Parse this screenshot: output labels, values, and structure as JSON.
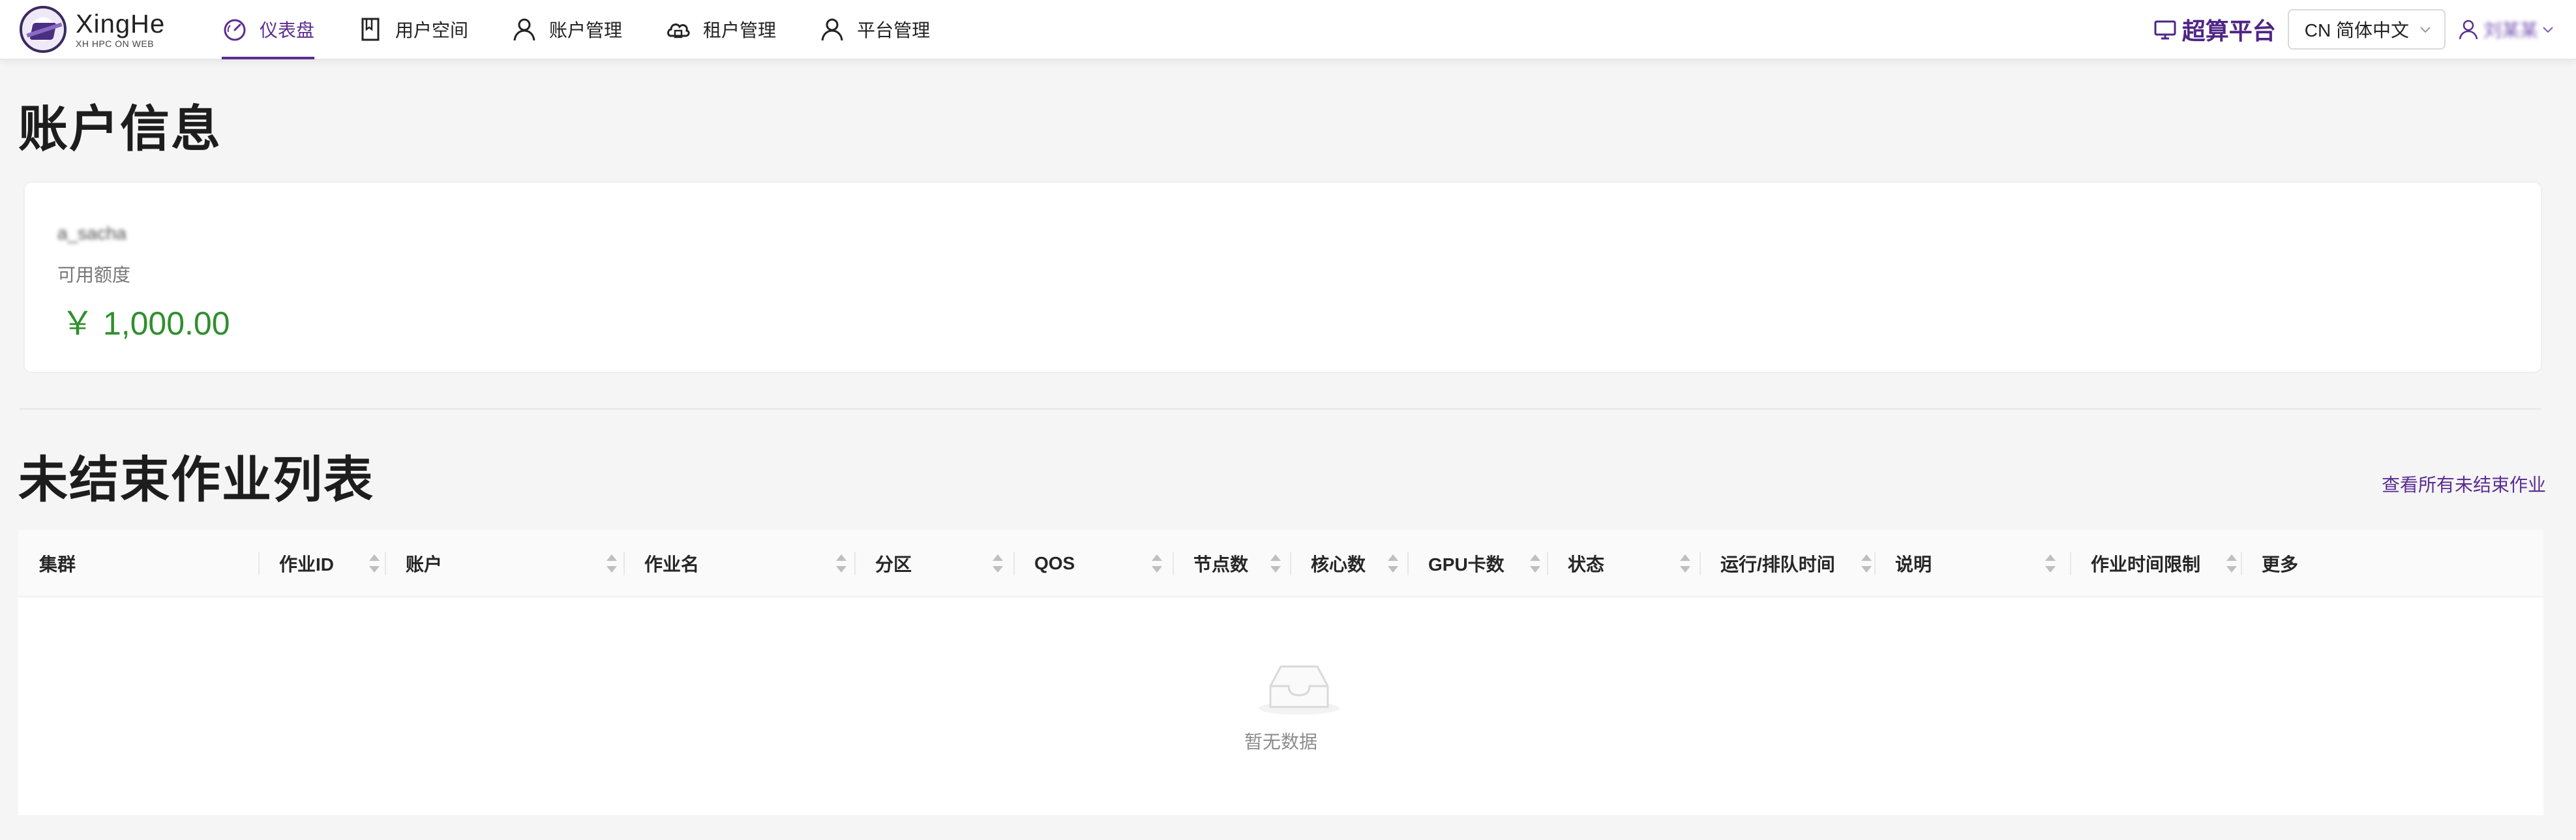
{
  "header": {
    "logo_title": "XingHe",
    "logo_subtitle": "XH HPC ON WEB",
    "nav": [
      {
        "label": "仪表盘",
        "icon": "dashboard-icon",
        "active": true
      },
      {
        "label": "用户空间",
        "icon": "book-icon",
        "active": false
      },
      {
        "label": "账户管理",
        "icon": "user-icon",
        "active": false
      },
      {
        "label": "租户管理",
        "icon": "cloud-icon",
        "active": false
      },
      {
        "label": "平台管理",
        "icon": "user-icon",
        "active": false
      }
    ],
    "platform_label": "超算平台",
    "language_value": "CN 简体中文",
    "username": "刘某某",
    "accent_color": "#5b2d91"
  },
  "account_section": {
    "title": "账户信息",
    "account_name": "a_sacha",
    "balance_label": "可用额度",
    "balance_value": "￥ 1,000.00",
    "balance_color": "#2f8f2f"
  },
  "jobs_section": {
    "title": "未结束作业列表",
    "view_all_link": "查看所有未结束作业",
    "columns": [
      {
        "label": "集群",
        "sortable": false
      },
      {
        "label": "作业ID",
        "sortable": true
      },
      {
        "label": "账户",
        "sortable": true
      },
      {
        "label": "作业名",
        "sortable": true
      },
      {
        "label": "分区",
        "sortable": true
      },
      {
        "label": "QOS",
        "sortable": true
      },
      {
        "label": "节点数",
        "sortable": true
      },
      {
        "label": "核心数",
        "sortable": true
      },
      {
        "label": "GPU卡数",
        "sortable": true
      },
      {
        "label": "状态",
        "sortable": true
      },
      {
        "label": "运行/排队时间",
        "sortable": true
      },
      {
        "label": "说明",
        "sortable": true
      },
      {
        "label": "作业时间限制",
        "sortable": true
      },
      {
        "label": "更多",
        "sortable": false
      }
    ],
    "rows": [],
    "empty_text": "暂无数据"
  }
}
